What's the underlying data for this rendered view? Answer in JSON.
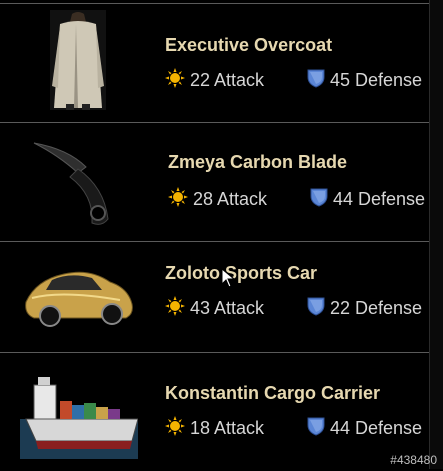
{
  "items": [
    {
      "name": "Executive Overcoat",
      "attack": "22 Attack",
      "defense": "45 Defense",
      "thumbnail": "overcoat-image"
    },
    {
      "name": "Zmeya Carbon Blade",
      "attack": "28 Attack",
      "defense": "44 Defense",
      "thumbnail": "karambit-blade-image"
    },
    {
      "name": "Zoloto Sports Car",
      "attack": "43 Attack",
      "defense": "22 Defense",
      "thumbnail": "gold-sports-car-image"
    },
    {
      "name": "Konstantin Cargo Carrier",
      "attack": "18 Attack",
      "defense": "44 Defense",
      "thumbnail": "cargo-ship-image"
    }
  ],
  "icons": {
    "attack": "sun-icon",
    "defense": "shield-icon"
  },
  "colors": {
    "name_text": "#e6d8b0",
    "stat_text": "#d6d6d6",
    "background": "#000000",
    "attack_icon": "#f5b400",
    "defense_icon": "#5b86d6"
  },
  "watermark": "#438480"
}
